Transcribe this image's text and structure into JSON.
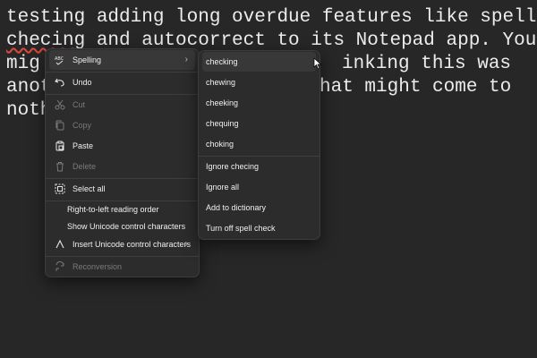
{
  "document": {
    "lines": [
      "                              ",
      "testing adding long overdue features like spell",
      "checing and autocorrect to its Notepad app. You",
      "mig",
      "anot",
      "noth"
    ],
    "line3_tail": "inking this was",
    "line4_tail": "hat might come to"
  },
  "context_menu": {
    "items": [
      {
        "label": "Spelling",
        "icon": "spellcheck-icon",
        "submenu": true
      },
      {
        "label": "Undo",
        "icon": "undo-icon"
      },
      {
        "label": "Cut",
        "icon": "cut-icon",
        "disabled": true
      },
      {
        "label": "Copy",
        "icon": "copy-icon",
        "disabled": true
      },
      {
        "label": "Paste",
        "icon": "paste-icon"
      },
      {
        "label": "Delete",
        "icon": "delete-icon",
        "disabled": true
      },
      {
        "label": "Select all",
        "icon": "select-all-icon"
      },
      {
        "label": "Right-to-left reading order"
      },
      {
        "label": "Show Unicode control characters"
      },
      {
        "label": "Insert Unicode control characters",
        "icon": "insert-unicode-icon",
        "submenu": true
      },
      {
        "label": "Reconversion",
        "icon": "reconversion-icon",
        "disabled": true
      }
    ]
  },
  "spelling_submenu": {
    "suggestions": [
      "checking",
      "chewing",
      "cheeking",
      "chequing",
      "choking"
    ],
    "actions": [
      "Ignore checing",
      "Ignore all",
      "Add to dictionary",
      "Turn off spell check"
    ]
  }
}
